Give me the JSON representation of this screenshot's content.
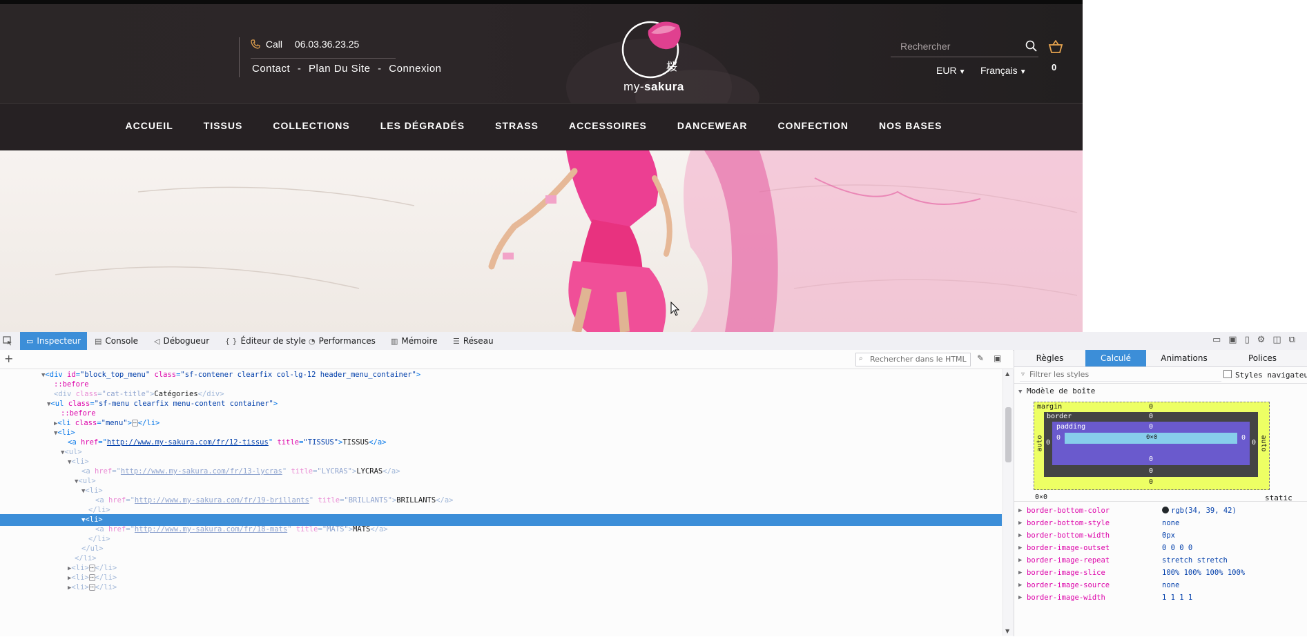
{
  "site": {
    "phone_label": "Call",
    "phone_number": "06.03.36.23.25",
    "top_links": [
      "Contact",
      "-",
      "Plan Du Site",
      "-",
      "Connexion"
    ],
    "logo_prefix": "my-",
    "logo_brand": "sakura",
    "logo_glyph": "桜",
    "search_placeholder": "Rechercher",
    "currency": "EUR",
    "language": "Français",
    "cart_count": "0",
    "nav": [
      {
        "label": "ACCUEIL"
      },
      {
        "label": "TISSUS"
      },
      {
        "label": "COLLECTIONS"
      },
      {
        "label": "LES DÉGRADÉS"
      },
      {
        "label": "STRASS"
      },
      {
        "label": "ACCESSOIRES"
      },
      {
        "label": "DANCEWEAR"
      },
      {
        "label": "CONFECTION"
      },
      {
        "label": "NOS BASES"
      }
    ],
    "accent_color": "#e7a44f"
  },
  "devtools": {
    "tabs": [
      {
        "label": "Inspecteur",
        "icon": "inspector-icon",
        "active": true
      },
      {
        "label": "Console",
        "icon": "console-icon",
        "active": false
      },
      {
        "label": "Débogueur",
        "icon": "debugger-icon",
        "active": false
      },
      {
        "label": "Éditeur de style",
        "icon": "style-editor-icon",
        "active": false
      },
      {
        "label": "Performances",
        "icon": "performance-icon",
        "active": false
      },
      {
        "label": "Mémoire",
        "icon": "memory-icon",
        "active": false
      },
      {
        "label": "Réseau",
        "icon": "network-icon",
        "active": false
      }
    ],
    "markup_search_placeholder": "Rechercher dans le HTML",
    "markup": {
      "l0": {
        "tag_open": "<div ",
        "a1": "id",
        "v1": "\"block_top_menu\"",
        "a2": "class",
        "v2": "\"sf-contener clearfix col-lg-12 header_menu_container\"",
        "tag_close": ">"
      },
      "l1": {
        "pseudo": "::before"
      },
      "l2": {
        "tag_open": "<div ",
        "a1": "class",
        "v1": "\"cat-title\"",
        "tag_close": ">",
        "text": "Catégories",
        "end": "</div>"
      },
      "l3": {
        "tag_open": "<ul ",
        "a1": "class",
        "v1": "\"sf-menu clearfix menu-content container\"",
        "tag_close": ">"
      },
      "l4": {
        "pseudo": "::before"
      },
      "l5": {
        "tag_open": "<li ",
        "a1": "class",
        "v1": "\"menu\"",
        "tag_close": ">",
        "end": "</li>"
      },
      "l6": {
        "tag": "<li>"
      },
      "l7": {
        "tag_open": "<a ",
        "a1": "href",
        "v1": "http://www.my-sakura.com/fr/12-tissus",
        "a2": "title",
        "v2": "\"TISSUS\"",
        "tag_close": ">",
        "text": "TISSUS",
        "end": "</a>"
      },
      "l8": {
        "tag": "<ul>"
      },
      "l9": {
        "tag": "<li>"
      },
      "l10": {
        "tag_open": "<a ",
        "a1": "href",
        "v1": "http://www.my-sakura.com/fr/13-lycras",
        "a2": "title",
        "v2": "\"LYCRAS\"",
        "tag_close": ">",
        "text": "LYCRAS",
        "end": "</a>"
      },
      "l11": {
        "tag": "<ul>"
      },
      "l12": {
        "tag": "<li>"
      },
      "l13": {
        "tag_open": "<a ",
        "a1": "href",
        "v1": "http://www.my-sakura.com/fr/19-brillants",
        "a2": "title",
        "v2": "\"BRILLANTS\"",
        "tag_close": ">",
        "text": "BRILLANTS",
        "end": "</a>"
      },
      "l14": {
        "tag": "</li>"
      },
      "l15": {
        "tag": "<li>"
      },
      "l16": {
        "tag_open": "<a ",
        "a1": "href",
        "v1": "http://www.my-sakura.com/fr/18-mats",
        "a2": "title",
        "v2": "\"MATS\"",
        "tag_close": ">",
        "text": "MATS",
        "end": "</a>"
      },
      "l17": {
        "tag": "</li>"
      },
      "l18": {
        "tag": "</ul>"
      },
      "l19": {
        "tag": "</li>"
      },
      "l20": {
        "tag_open": "<li>",
        "end": "</li>"
      },
      "l21": {
        "tag_open": "<li>",
        "end": "</li>"
      },
      "l22": {
        "tag_open": "<li>",
        "end": "</li>"
      }
    },
    "side_tabs": [
      {
        "label": "Règles",
        "active": false
      },
      {
        "label": "Calculé",
        "active": true
      },
      {
        "label": "Animations",
        "active": false
      },
      {
        "label": "Polices",
        "active": false
      }
    ],
    "filter_placeholder": "Filtrer les styles",
    "browser_styles_label": "Styles navigateur",
    "box_model_title": "Modèle de boîte",
    "box_model": {
      "margin_label": "margin",
      "border_label": "border",
      "padding_label": "padding",
      "margin_top": "0",
      "margin_bottom": "0",
      "margin_left": "auto",
      "margin_right": "auto",
      "border_top": "0",
      "border_bottom": "0",
      "border_left": "0",
      "border_right": "0",
      "padding_top": "0",
      "padding_bottom": "0",
      "padding_left": "0",
      "padding_right": "0",
      "content": "0×0",
      "size": "0×0",
      "position": "static"
    },
    "computed": [
      {
        "name": "border-bottom-color",
        "value": "rgb(34, 39, 42)",
        "swatch": "#22272a"
      },
      {
        "name": "border-bottom-style",
        "value": "none"
      },
      {
        "name": "border-bottom-width",
        "value": "0px"
      },
      {
        "name": "border-image-outset",
        "value": "0 0 0 0"
      },
      {
        "name": "border-image-repeat",
        "value": "stretch stretch"
      },
      {
        "name": "border-image-slice",
        "value": "100% 100% 100% 100%"
      },
      {
        "name": "border-image-source",
        "value": "none"
      },
      {
        "name": "border-image-width",
        "value": "1 1 1 1"
      }
    ]
  }
}
